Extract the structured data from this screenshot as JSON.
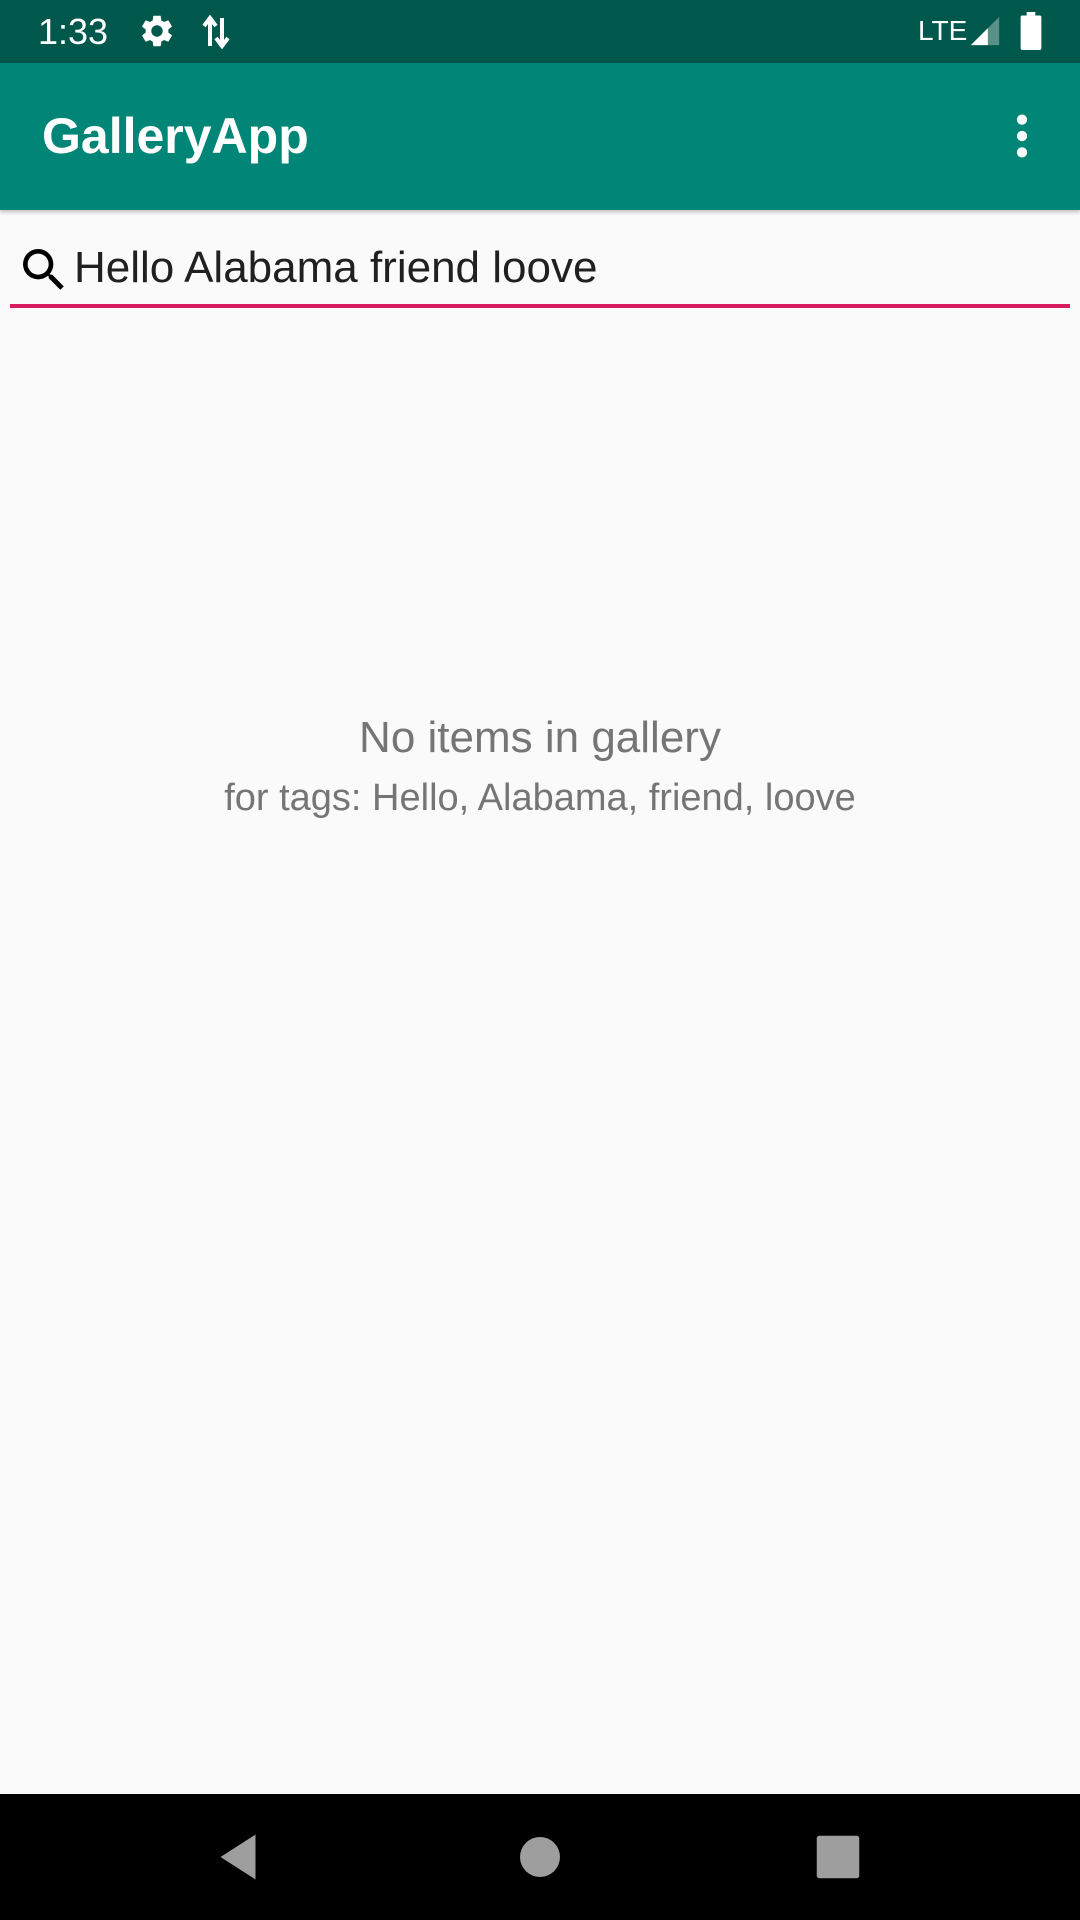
{
  "status_bar": {
    "time": "1:33",
    "network": "LTE",
    "icons": [
      "settings-icon",
      "data-transfer-icon",
      "signal-icon",
      "battery-icon"
    ],
    "background": "#00574b"
  },
  "app_bar": {
    "title": "GalleryApp",
    "overflow_icon": "more-vert-icon",
    "background": "#008577"
  },
  "search": {
    "icon": "search-icon",
    "value": "Hello Alabama friend loove",
    "underline_color": "#d81b60"
  },
  "empty_state": {
    "title": "No items in gallery",
    "subtitle": "for tags: Hello, Alabama, friend, loove"
  },
  "nav_bar": {
    "buttons": [
      "back-icon",
      "home-icon",
      "recents-icon"
    ]
  }
}
